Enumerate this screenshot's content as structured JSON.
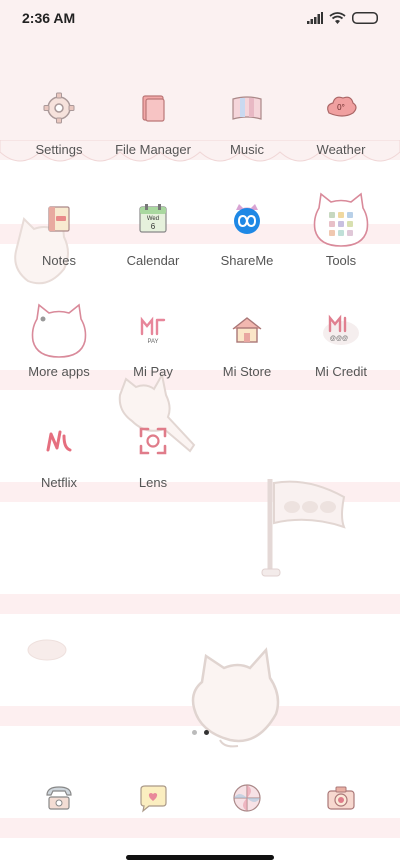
{
  "status": {
    "time": "2:36 AM"
  },
  "apps": [
    {
      "label": "Settings",
      "icon": "gear-icon"
    },
    {
      "label": "File Manager",
      "icon": "folder-icon"
    },
    {
      "label": "Music",
      "icon": "music-icon"
    },
    {
      "label": "Weather",
      "icon": "weather-icon"
    },
    {
      "label": "Notes",
      "icon": "notes-icon"
    },
    {
      "label": "Calendar",
      "icon": "calendar-icon"
    },
    {
      "label": "ShareMe",
      "icon": "shareme-icon"
    },
    {
      "label": "Tools",
      "icon": "tools-folder-icon"
    },
    {
      "label": "More apps",
      "icon": "more-apps-folder-icon"
    },
    {
      "label": "Mi Pay",
      "icon": "mi-pay-icon"
    },
    {
      "label": "Mi Store",
      "icon": "mi-store-icon"
    },
    {
      "label": "Mi Credit",
      "icon": "mi-credit-icon"
    },
    {
      "label": "Netflix",
      "icon": "netflix-icon"
    },
    {
      "label": "Lens",
      "icon": "lens-icon"
    }
  ],
  "calendar_icon": {
    "day_name": "Wed",
    "day_num": "6"
  },
  "weather_icon": {
    "temp": "0°"
  },
  "mi_pay_icon": {
    "text": "PAY"
  },
  "mi_credit_icon": {
    "text": "@@@"
  },
  "dock": [
    {
      "icon": "phone-icon"
    },
    {
      "icon": "messages-icon"
    },
    {
      "icon": "browser-icon"
    },
    {
      "icon": "camera-icon"
    }
  ],
  "pages": {
    "count": 2,
    "current": 2
  }
}
